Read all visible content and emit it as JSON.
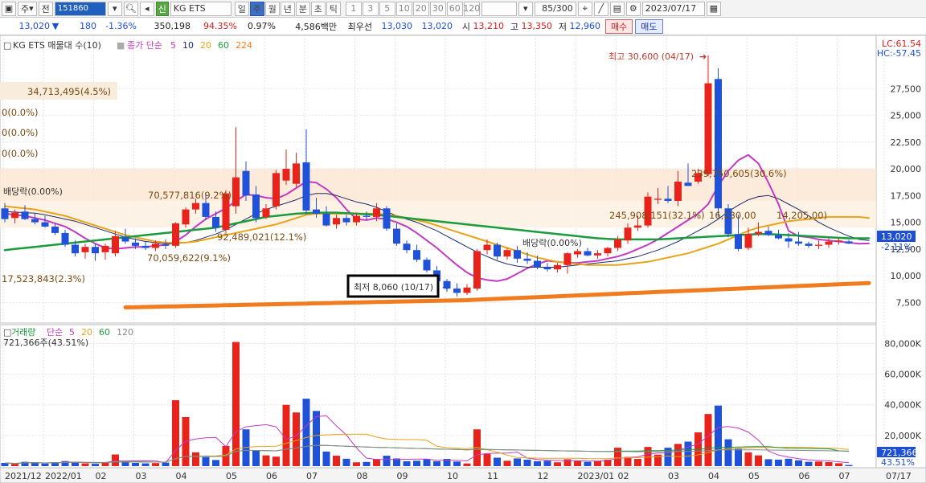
{
  "toolbar": {
    "market": "주",
    "chart_kind": "전",
    "code": "151860",
    "credit_tag": "신",
    "stock_name": "KG ETS",
    "periods": [
      "일",
      "주",
      "월",
      "년",
      "분",
      "초",
      "틱"
    ],
    "selected_period": "주",
    "intervals": [
      "1",
      "3",
      "5",
      "10",
      "20",
      "30",
      "60",
      "120"
    ],
    "count": "85/300",
    "date": "2023/07/17"
  },
  "info": {
    "price": "13,020",
    "change": "180",
    "change_pct": "-1.36%",
    "volume": "350,198",
    "vol_ratio": "94.35%",
    "turnover_pct": "0.97%",
    "amount": "4,586백만",
    "best_label": "최우선",
    "ask": "13,030",
    "bid": "13,020",
    "open_label": "시",
    "open": "13,210",
    "high_label": "고",
    "high": "13,350",
    "low_label": "저",
    "low": "12,960",
    "buy_label": "매수",
    "sell_label": "매도"
  },
  "price_panel": {
    "title": "KG ETS 매물대 수(10)",
    "ma_label": "종가 단순",
    "ma_periods": [
      "5",
      "10",
      "20",
      "60",
      "224"
    ],
    "ma_colors": [
      "#c23ac2",
      "#1b2a6b",
      "#e8a317",
      "#1a9b3c",
      "#f07c1f"
    ],
    "lc": "LC:61.54",
    "hc": "HC:-57.45",
    "current_price": "13,020",
    "current_pct": "-2.11%",
    "volume_profile_labels": [
      "34,713,495(4.5%)",
      "0(0.0%)",
      "0(0.0%)",
      "0(0.0%)",
      "17,523,843(2.3%)",
      "70,577,816(9.2%)",
      "92,489,021(12.1%)",
      "70,059,622(9.1%)",
      "245,908,151(32.1%)",
      "239,750,605(30.6%)",
      "16,130,00",
      "14,205,00)"
    ],
    "annotations": {
      "dividend1": "배당락(0.00%)",
      "dividend2": "배당락(0.00%)",
      "high": "최고 30,600 (04/17)",
      "low": "최저 8,060 (10/17)"
    }
  },
  "volume_panel": {
    "title": "거래량",
    "ma_label": "단순",
    "ma_periods": [
      "5",
      "20",
      "60",
      "120"
    ],
    "current": "721,366주(43.51%)",
    "current_tag": "721,366",
    "current_pct": "43.51%"
  },
  "x_axis": [
    "2021/12",
    "2022/01",
    "02",
    "03",
    "04",
    "05",
    "06",
    "07",
    "08",
    "09",
    "10",
    "11",
    "12",
    "2023/01",
    "02",
    "03",
    "04",
    "05",
    "06",
    "07",
    "07/17"
  ],
  "chart_data": {
    "type": "candlestick",
    "price_axis_ticks": [
      "27,500",
      "25,000",
      "22,500",
      "20,000",
      "17,500",
      "15,000",
      "12,500",
      "10,000",
      "7,500"
    ],
    "volume_axis_ticks": [
      "80,000K",
      "60,000K",
      "40,000K",
      "20,000K"
    ],
    "price_ylim": [
      5800,
      30600
    ],
    "volume_ylim": [
      0,
      86000
    ],
    "candles": [
      {
        "o": 16300,
        "h": 16800,
        "l": 15000,
        "c": 15300
      },
      {
        "o": 15400,
        "h": 16200,
        "l": 14900,
        "c": 15900
      },
      {
        "o": 16000,
        "h": 16600,
        "l": 15200,
        "c": 15300
      },
      {
        "o": 15300,
        "h": 15800,
        "l": 14800,
        "c": 15000
      },
      {
        "o": 15000,
        "h": 15600,
        "l": 14500,
        "c": 14600
      },
      {
        "o": 14600,
        "h": 14900,
        "l": 13800,
        "c": 14000
      },
      {
        "o": 14000,
        "h": 14300,
        "l": 12700,
        "c": 12900
      },
      {
        "o": 12900,
        "h": 13300,
        "l": 11800,
        "c": 12100
      },
      {
        "o": 12200,
        "h": 13000,
        "l": 11600,
        "c": 12700
      },
      {
        "o": 12700,
        "h": 13000,
        "l": 11400,
        "c": 12100
      },
      {
        "o": 12200,
        "h": 13000,
        "l": 11500,
        "c": 12800
      },
      {
        "o": 12100,
        "h": 14200,
        "l": 11800,
        "c": 13700
      },
      {
        "o": 13600,
        "h": 14400,
        "l": 13000,
        "c": 13200
      },
      {
        "o": 13100,
        "h": 13500,
        "l": 12500,
        "c": 12800
      },
      {
        "o": 12800,
        "h": 13200,
        "l": 12400,
        "c": 12600
      },
      {
        "o": 12600,
        "h": 13300,
        "l": 12300,
        "c": 13000
      },
      {
        "o": 12900,
        "h": 13400,
        "l": 12500,
        "c": 12800
      },
      {
        "o": 12800,
        "h": 15000,
        "l": 12600,
        "c": 14900
      },
      {
        "o": 14800,
        "h": 16400,
        "l": 14500,
        "c": 16200
      },
      {
        "o": 16200,
        "h": 17200,
        "l": 15800,
        "c": 16800
      },
      {
        "o": 16800,
        "h": 17700,
        "l": 15200,
        "c": 15500
      },
      {
        "o": 15500,
        "h": 16000,
        "l": 14100,
        "c": 14500
      },
      {
        "o": 14300,
        "h": 18000,
        "l": 14000,
        "c": 17700
      },
      {
        "o": 16500,
        "h": 23900,
        "l": 15800,
        "c": 19200
      },
      {
        "o": 19800,
        "h": 20700,
        "l": 17000,
        "c": 17500
      },
      {
        "o": 17600,
        "h": 18400,
        "l": 15000,
        "c": 15400
      },
      {
        "o": 15500,
        "h": 16700,
        "l": 15300,
        "c": 16300
      },
      {
        "o": 16500,
        "h": 19900,
        "l": 16200,
        "c": 19600
      },
      {
        "o": 18900,
        "h": 21800,
        "l": 18500,
        "c": 20000
      },
      {
        "o": 18600,
        "h": 21500,
        "l": 18300,
        "c": 20500
      },
      {
        "o": 20600,
        "h": 23700,
        "l": 15800,
        "c": 16100
      },
      {
        "o": 16200,
        "h": 17300,
        "l": 15400,
        "c": 15800
      },
      {
        "o": 15800,
        "h": 16500,
        "l": 14600,
        "c": 14700
      },
      {
        "o": 14800,
        "h": 15700,
        "l": 14400,
        "c": 15400
      },
      {
        "o": 15400,
        "h": 15700,
        "l": 14700,
        "c": 15000
      },
      {
        "o": 15000,
        "h": 15900,
        "l": 14700,
        "c": 15600
      },
      {
        "o": 15600,
        "h": 16000,
        "l": 15200,
        "c": 15500
      },
      {
        "o": 15500,
        "h": 16800,
        "l": 15100,
        "c": 16300
      },
      {
        "o": 16300,
        "h": 16500,
        "l": 14200,
        "c": 14400
      },
      {
        "o": 14400,
        "h": 14900,
        "l": 12800,
        "c": 13000
      },
      {
        "o": 13000,
        "h": 13300,
        "l": 12100,
        "c": 12400
      },
      {
        "o": 12400,
        "h": 12900,
        "l": 11300,
        "c": 11500
      },
      {
        "o": 11500,
        "h": 11700,
        "l": 10300,
        "c": 10500
      },
      {
        "o": 10500,
        "h": 10900,
        "l": 9200,
        "c": 9500
      },
      {
        "o": 9500,
        "h": 9700,
        "l": 8500,
        "c": 8800
      },
      {
        "o": 8800,
        "h": 9300,
        "l": 8060,
        "c": 8400
      },
      {
        "o": 8400,
        "h": 9200,
        "l": 8200,
        "c": 8900
      },
      {
        "o": 8800,
        "h": 12500,
        "l": 8600,
        "c": 12300
      },
      {
        "o": 12400,
        "h": 13400,
        "l": 12000,
        "c": 12900
      },
      {
        "o": 12900,
        "h": 13100,
        "l": 11500,
        "c": 11800
      },
      {
        "o": 11800,
        "h": 12600,
        "l": 11500,
        "c": 12400
      },
      {
        "o": 12400,
        "h": 12800,
        "l": 11200,
        "c": 11600
      },
      {
        "o": 11600,
        "h": 12200,
        "l": 11100,
        "c": 11400
      },
      {
        "o": 11400,
        "h": 11900,
        "l": 10600,
        "c": 10800
      },
      {
        "o": 10800,
        "h": 11200,
        "l": 10400,
        "c": 10600
      },
      {
        "o": 10600,
        "h": 11200,
        "l": 10300,
        "c": 11000
      },
      {
        "o": 11000,
        "h": 12200,
        "l": 10200,
        "c": 12100
      },
      {
        "o": 12000,
        "h": 12500,
        "l": 11700,
        "c": 12300
      },
      {
        "o": 12300,
        "h": 12600,
        "l": 11800,
        "c": 11900
      },
      {
        "o": 11900,
        "h": 12400,
        "l": 11600,
        "c": 12100
      },
      {
        "o": 12100,
        "h": 12700,
        "l": 11800,
        "c": 12600
      },
      {
        "o": 12600,
        "h": 13700,
        "l": 12300,
        "c": 13400
      },
      {
        "o": 13300,
        "h": 14900,
        "l": 13000,
        "c": 14500
      },
      {
        "o": 14500,
        "h": 15600,
        "l": 14200,
        "c": 14700
      },
      {
        "o": 14700,
        "h": 17800,
        "l": 14500,
        "c": 17400
      },
      {
        "o": 17100,
        "h": 18200,
        "l": 16700,
        "c": 17200
      },
      {
        "o": 17200,
        "h": 18400,
        "l": 16800,
        "c": 17000
      },
      {
        "o": 17000,
        "h": 19800,
        "l": 16500,
        "c": 18800
      },
      {
        "o": 18700,
        "h": 20500,
        "l": 18400,
        "c": 18400
      },
      {
        "o": 18800,
        "h": 20000,
        "l": 18600,
        "c": 19600
      },
      {
        "o": 19500,
        "h": 30600,
        "l": 19300,
        "c": 28000
      },
      {
        "o": 28400,
        "h": 29400,
        "l": 15500,
        "c": 16300
      },
      {
        "o": 16300,
        "h": 16700,
        "l": 13600,
        "c": 13900
      },
      {
        "o": 13900,
        "h": 15700,
        "l": 12300,
        "c": 12500
      },
      {
        "o": 12600,
        "h": 14500,
        "l": 12400,
        "c": 13900
      },
      {
        "o": 13900,
        "h": 15000,
        "l": 13700,
        "c": 14100
      },
      {
        "o": 14200,
        "h": 14600,
        "l": 13700,
        "c": 13800
      },
      {
        "o": 13800,
        "h": 14300,
        "l": 13400,
        "c": 13500
      },
      {
        "o": 13500,
        "h": 14000,
        "l": 12600,
        "c": 13200
      },
      {
        "o": 13200,
        "h": 14100,
        "l": 12800,
        "c": 13000
      },
      {
        "o": 13000,
        "h": 13200,
        "l": 12600,
        "c": 12800
      },
      {
        "o": 12800,
        "h": 13300,
        "l": 12500,
        "c": 12900
      },
      {
        "o": 12900,
        "h": 13500,
        "l": 12600,
        "c": 13200
      },
      {
        "o": 13200,
        "h": 13500,
        "l": 12900,
        "c": 13300
      },
      {
        "o": 13210,
        "h": 13350,
        "l": 12960,
        "c": 13020
      }
    ],
    "volumes": [
      2100,
      1500,
      2800,
      2500,
      1700,
      2600,
      3300,
      2900,
      1800,
      1500,
      2600,
      7600,
      3300,
      2100,
      1800,
      2000,
      2300,
      43000,
      32000,
      9000,
      5900,
      4000,
      13200,
      81000,
      24000,
      10000,
      7000,
      6200,
      40000,
      35000,
      44000,
      36000,
      9500,
      6800,
      4800,
      2500,
      2700,
      4600,
      6800,
      5000,
      3200,
      3500,
      4500,
      3200,
      4700,
      3000,
      1700,
      24000,
      8000,
      5500,
      3500,
      5000,
      4200,
      3200,
      3500,
      2500,
      4500,
      3500,
      2800,
      3200,
      4200,
      12000,
      6000,
      4700,
      12500,
      7500,
      12000,
      14500,
      16000,
      22000,
      34000,
      39500,
      17500,
      11300,
      9000,
      7000,
      4500,
      4200,
      4800,
      3800,
      2800,
      3000,
      2600,
      1900,
      721
    ],
    "ma_prices": {
      "5": [
        15800,
        15700,
        15600,
        15400,
        15200,
        14900,
        14600,
        14100,
        13500,
        13000,
        12600,
        12500,
        12600,
        12700,
        12700,
        12800,
        12900,
        13200,
        13800,
        14600,
        15300,
        15800,
        16300,
        17000,
        17600,
        17500,
        17300,
        17200,
        17600,
        18200,
        18800,
        18700,
        18100,
        17300,
        16200,
        15300,
        15200,
        15400,
        15300,
        15000,
        14600,
        14000,
        13300,
        12600,
        11800,
        11000,
        10300,
        9800,
        9600,
        9500,
        9700,
        10200,
        10700,
        11100,
        11400,
        11300,
        11200,
        11200,
        11300,
        11400,
        11600,
        11800,
        12100,
        12500,
        12900,
        13400,
        14000,
        14600,
        15200,
        15800,
        16700,
        18400,
        19800,
        20800,
        21300,
        20500,
        18700,
        16700,
        14200,
        13700,
        13600,
        13400,
        13300,
        13200,
        13100,
        13000,
        13020
      ],
      "10": [
        16000,
        15950,
        15900,
        15850,
        15700,
        15500,
        15300,
        15100,
        14800,
        14500,
        14200,
        13900,
        13600,
        13400,
        13200,
        13100,
        13000,
        13000,
        13100,
        13300,
        13600,
        13900,
        14300,
        14800,
        15300,
        15800,
        16200,
        16500,
        16800,
        17100,
        17500,
        17700,
        17700,
        17500,
        17200,
        16900,
        16700,
        16400,
        16000,
        15600,
        15300,
        15000,
        14600,
        14200,
        13700,
        13200,
        12700,
        12200,
        11800,
        11400,
        11100,
        10900,
        10800,
        10800,
        10800,
        10800,
        10900,
        11000,
        11100,
        11200,
        11300,
        11400,
        11600,
        11800,
        12100,
        12400,
        12800,
        13200,
        13700,
        14200,
        14700,
        15300,
        16000,
        16600,
        17100,
        17400,
        17500,
        17200,
        16700,
        16200,
        15600,
        15000,
        14500,
        14100,
        13700,
        13400,
        13300
      ],
      "20": [
        16500,
        16400,
        16300,
        16200,
        16000,
        15800,
        15600,
        15300,
        15000,
        14700,
        14400,
        14100,
        13800,
        13600,
        13400,
        13200,
        13100,
        13100,
        13100,
        13200,
        13400,
        13600,
        13800,
        14000,
        14200,
        14400,
        14600,
        14800,
        15100,
        15400,
        15700,
        15800,
        15800,
        15800,
        15800,
        15800,
        15800,
        15800,
        15700,
        15600,
        15400,
        15200,
        15000,
        14700,
        14400,
        14100,
        13800,
        13500,
        13200,
        12900,
        12600,
        12300,
        12000,
        11700,
        11500,
        11300,
        11200,
        11100,
        11000,
        11000,
        11000,
        11000,
        11100,
        11200,
        11300,
        11500,
        11700,
        11900,
        12100,
        12400,
        12700,
        13000,
        13400,
        13800,
        14200,
        14500,
        14700,
        14900,
        15100,
        15200,
        15300,
        15400,
        15500,
        15500,
        15500,
        15500,
        15400
      ],
      "60": [
        12400,
        12500,
        12600,
        12700,
        12800,
        12900,
        13000,
        13100,
        13200,
        13300,
        13400,
        13500,
        13600,
        13700,
        13800,
        13900,
        14000,
        14100,
        14200,
        14300,
        14400,
        14500,
        14700,
        14900,
        15100,
        15300,
        15500,
        15600,
        15700,
        15800,
        15850,
        15900,
        15900,
        15900,
        15850,
        15800,
        15750,
        15700,
        15600,
        15500,
        15400,
        15300,
        15200,
        15100,
        15000,
        14900,
        14800,
        14700,
        14600,
        14500,
        14400,
        14300,
        14200,
        14100,
        14000,
        13900,
        13800,
        13700,
        13600,
        13500,
        13450,
        13400,
        13400,
        13400,
        13400,
        13400,
        13450,
        13500,
        13550,
        13600,
        13650,
        13700,
        13750,
        13800,
        13850,
        13900,
        13900,
        13850,
        13800,
        13750,
        13700,
        13650,
        13600,
        13550,
        13500,
        13500,
        13500
      ],
      "224": [
        6800,
        6820,
        6840,
        6860,
        6880,
        6900,
        6920,
        6940,
        6960,
        6980,
        7000,
        7020,
        7040,
        7060,
        7080,
        7100,
        7120,
        7140,
        7160,
        7180,
        7200,
        7220,
        7240,
        7260,
        7280,
        7300,
        7320,
        7340,
        7360,
        7380,
        7400,
        7420,
        7440,
        7460,
        7480,
        7500,
        7520,
        7540,
        7560,
        7580,
        7600,
        7620,
        7640,
        7660,
        7680,
        7700,
        7720,
        7760,
        7800,
        7840,
        7880,
        7920,
        7960,
        8000,
        8040,
        8080,
        8120,
        8160,
        8200,
        8240,
        8280,
        8320,
        8360,
        8400,
        8440,
        8480,
        8520,
        8560,
        8600,
        8640,
        8680,
        8720,
        8760,
        8800,
        8840,
        8880,
        8920,
        8960,
        9000,
        9040,
        9080,
        9120,
        9160,
        9200,
        9240,
        9280,
        9320
      ]
    }
  }
}
